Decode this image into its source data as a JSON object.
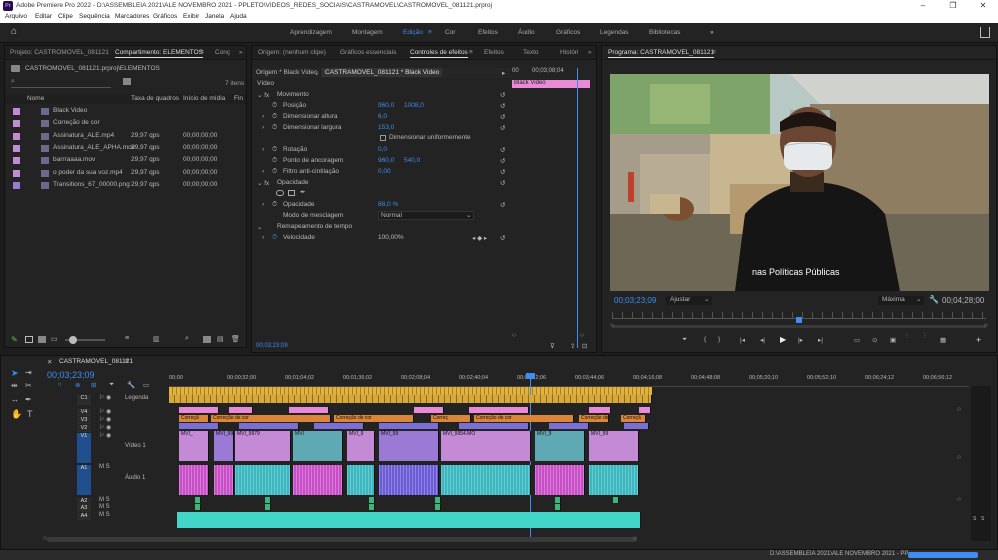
{
  "app": {
    "icon": "Pr",
    "title": "Adobe Premiere Pro 2022 - D:\\ASSEMBLEIA 2021\\ALE NOVEMBRO 2021 - PPLETO\\VIDEOS_REDES_SOCIAIS\\CASTRAMOVEL\\CASTROMOVEL_081121.prproj"
  },
  "menu": [
    "Arquivo",
    "Editar",
    "Clipe",
    "Sequência",
    "Marcadores",
    "Gráficos",
    "Exibir",
    "Janela",
    "Ajuda"
  ],
  "workspaces": [
    "Aprendizagem",
    "Montagem",
    "Edição",
    "Cor",
    "Efeitos",
    "Áudio",
    "Gráficos",
    "Legendas",
    "Bibliotecas"
  ],
  "active_workspace": "Edição",
  "project": {
    "tabs": [
      "Projeto: CASTROMOVEL_081121",
      "Compartimento: ELEMENTOS",
      "Conç"
    ],
    "path": "CASTROMOVEL_081121.prproj\\ELEMENTOS",
    "item_count": "7 itens",
    "columns": [
      "Nome",
      "Taxa de quadros",
      "Início de mídia",
      "Fin"
    ],
    "items": [
      {
        "name": "Black Video",
        "fps": "",
        "start": "",
        "color": "#c48ad6"
      },
      {
        "name": "Correção de cor",
        "fps": "",
        "start": "",
        "color": "#c48ad6"
      },
      {
        "name": "Assinatura_ALE.mp4",
        "fps": "29,97 qps",
        "start": "00;00;00;00",
        "color": "#c48ad6"
      },
      {
        "name": "Assinatura_ALE_APHA.mov",
        "fps": "29,97 qps",
        "start": "00;00;00;00",
        "color": "#c48ad6"
      },
      {
        "name": "barrraaaa.mov",
        "fps": "29,97 qps",
        "start": "00;00;00;00",
        "color": "#c48ad6"
      },
      {
        "name": "o poder da sua voz.mp4",
        "fps": "29,97 qps",
        "start": "00;00;00;00",
        "color": "#c48ad6"
      },
      {
        "name": "Transitions_67_00000.png",
        "fps": "29,97 qps",
        "start": "00;00;00;00",
        "color": "#9b7ad6"
      }
    ]
  },
  "effects": {
    "tabs": [
      "Origem: (nenhum clipe)",
      "Gráficos essenciais",
      "Controles de efeitos",
      "Efeitos",
      "Texto",
      "Históri"
    ],
    "master": "Origem * Black Video",
    "clip": "CASTRAMOVEL_081121 * Black Video",
    "mini_timecode": "00;03;08;04",
    "clip_label": "Black Video",
    "video_label": "Vídeo",
    "movement": "Movimento",
    "position": {
      "label": "Posição",
      "x": "960,0",
      "y": "1008,0"
    },
    "height": {
      "label": "Dimensionar altura",
      "v": "6,0"
    },
    "width": {
      "label": "Dimensionar largura",
      "v": "153,0"
    },
    "uniform": "Dimensionar uniformemente",
    "rotation": {
      "label": "Rotação",
      "v": "0,0"
    },
    "anchor": {
      "label": "Ponto de ancoragem",
      "x": "960,0",
      "y": "540,0"
    },
    "flicker": {
      "label": "Filtro anti-cintilação",
      "v": "0,00"
    },
    "opacity_section": "Opacidade",
    "opacity": {
      "label": "Opacidade",
      "v": "88,0 %"
    },
    "blend": {
      "label": "Modo de mesclagem",
      "v": "Normal"
    },
    "remap": "Remapeamento de tempo",
    "speed": {
      "label": "Velocidade",
      "v": "100,00%"
    },
    "timecode": "00;03;23;09"
  },
  "program": {
    "tab": "Programa: CASTRAMOVEL_081121",
    "subtitle": "nas Políticas Públicas",
    "timecode": "00;03;23;09",
    "fit": "Ajustar",
    "quality": "Máxima",
    "duration": "00;04;28;00"
  },
  "timeline": {
    "tab": "CASTRAMOVEL_081121",
    "timecode": "00;03;23;09",
    "ruler": [
      "00;00",
      "00;00;32;00",
      "00;01;04;02",
      "00;01;36;02",
      "00;02;08;04",
      "00;02;40;04",
      "00;03;12;06",
      "00;03;44;06",
      "00;04;16;08",
      "00;04;48;08",
      "00;05;20;10",
      "00;05;52;10",
      "00;06;24;12",
      "00;06;56;12"
    ],
    "tracks": [
      {
        "id": "C1",
        "name": "Legenda"
      },
      {
        "id": "V4",
        "name": ""
      },
      {
        "id": "V3",
        "name": ""
      },
      {
        "id": "V2",
        "name": ""
      },
      {
        "id": "V1",
        "name": "Vídeo 1"
      },
      {
        "id": "A1",
        "name": "Áudio 1"
      },
      {
        "id": "A2",
        "name": ""
      },
      {
        "id": "A3",
        "name": ""
      },
      {
        "id": "A4",
        "name": ""
      }
    ],
    "clip_names": [
      "Correçã",
      "Correção de cor",
      "Correção de cor",
      "Correç",
      "Correção de cor",
      "Correção de cor",
      "Correçã"
    ],
    "video_names": [
      "MVI_",
      "MVI_99",
      "MVI_9979",
      "MVI",
      "MVI_9",
      "MVI_99",
      "MVI_9954.MO",
      "MVI_9",
      "MVI_99"
    ],
    "status_path": "D:\\ASSEMBLEIA 2021\\ALE NOVEMBRO 2021 - PP...",
    "db_labels": [
      "S",
      "S"
    ]
  }
}
